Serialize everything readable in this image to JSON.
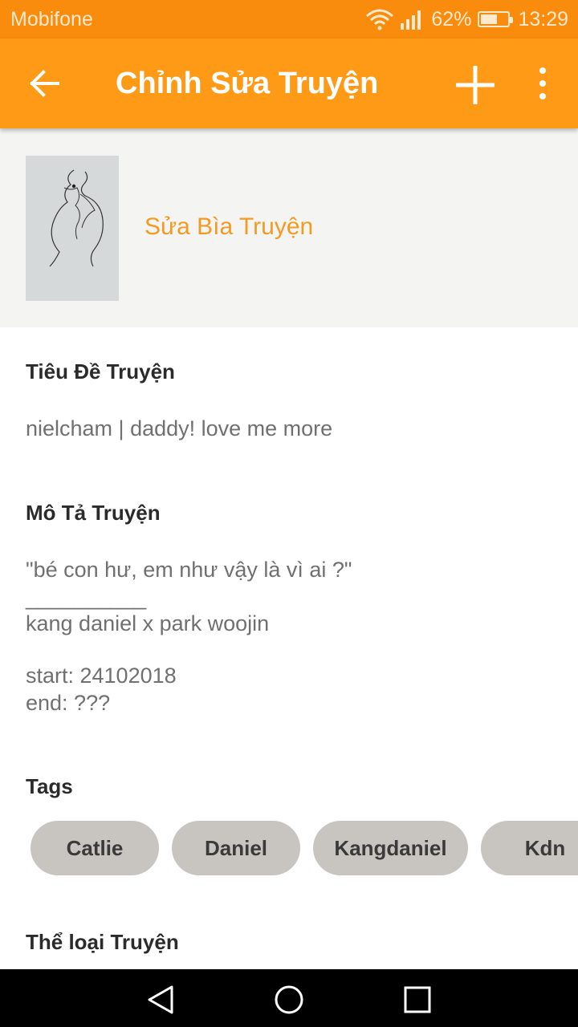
{
  "status_bar": {
    "carrier": "Mobifone",
    "battery": "62%",
    "battery_level": 0.62,
    "time": "13:29"
  },
  "app_bar": {
    "title": "Chỉnh Sửa Truyện"
  },
  "cover": {
    "edit_label": "Sửa Bìa Truyện"
  },
  "story_title": {
    "label": "Tiêu Đề Truyện",
    "value": "nielcham | daddy! love me more"
  },
  "description": {
    "label": "Mô Tả Truyện",
    "lines": [
      "\"bé con hư, em như vậy là vì ai ?\"",
      "__________",
      "kang daniel x park woojin",
      "",
      "start: 24102018",
      "end: ???"
    ]
  },
  "tags": {
    "label": "Tags",
    "items": [
      "Catlie",
      "Daniel",
      "Kangdaniel",
      "Kdn"
    ]
  },
  "category": {
    "label": "Thể loại Truyện"
  }
}
